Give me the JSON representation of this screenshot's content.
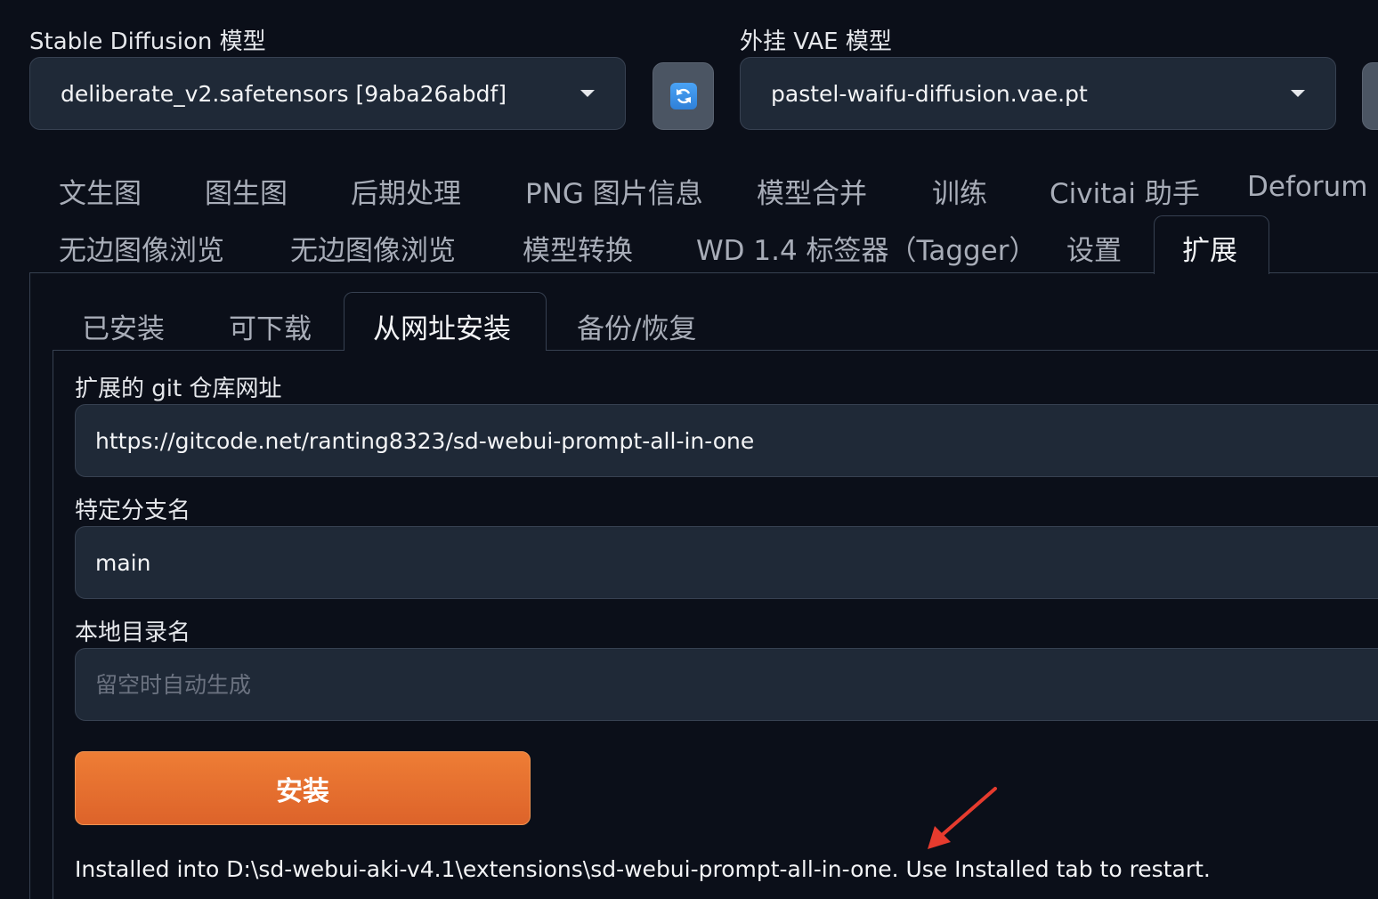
{
  "model_selector": {
    "label": "Stable Diffusion 模型",
    "value": "deliberate_v2.safetensors [9aba26abdf]"
  },
  "vae_selector": {
    "label": "外挂 VAE 模型",
    "value": "pastel-waifu-diffusion.vae.pt"
  },
  "main_tabs": {
    "row1": [
      "文生图",
      "图生图",
      "后期处理",
      "PNG 图片信息",
      "模型合并",
      "训练",
      "Civitai 助手",
      "Deforum"
    ],
    "row2": [
      "无边图像浏览",
      "无边图像浏览",
      "模型转换",
      "WD 1.4 标签器（Tagger）",
      "设置",
      "扩展"
    ],
    "active": "扩展"
  },
  "sub_tabs": {
    "items": [
      "已安装",
      "可下载",
      "从网址安装",
      "备份/恢复"
    ],
    "active": "从网址安装"
  },
  "form": {
    "git_url_label": "扩展的 git 仓库网址",
    "git_url_value": "https://gitcode.net/ranting8323/sd-webui-prompt-all-in-one",
    "branch_label": "特定分支名",
    "branch_value": "main",
    "local_dir_label": "本地目录名",
    "local_dir_placeholder": "留空时自动生成",
    "install_label": "安装"
  },
  "result_text": "Installed into D:\\sd-webui-aki-v4.1\\extensions\\sd-webui-prompt-all-in-one. Use Installed tab to restart.",
  "colors": {
    "background": "#0b0f19",
    "panel": "#1f2937",
    "accent_orange": "#e8702f",
    "annotation_arrow": "#e63b2e"
  }
}
